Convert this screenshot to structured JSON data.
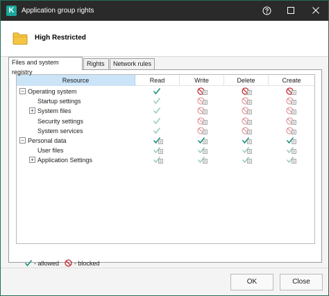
{
  "window": {
    "title": "Application group rights",
    "logo_letter": "K",
    "accent_color": "#1aa79b"
  },
  "header": {
    "group_name": "High Restricted",
    "icon": "folder-icon"
  },
  "tabs": [
    {
      "label": "Files and system registry",
      "active": true
    },
    {
      "label": "Rights",
      "active": false
    },
    {
      "label": "Network rules",
      "active": false
    }
  ],
  "grid": {
    "columns": [
      "Resource",
      "Read",
      "Write",
      "Delete",
      "Create"
    ],
    "rows": [
      {
        "label": "Operating system",
        "toggle": "−",
        "level": 0,
        "rights": [
          "allowed",
          "blocked-sub",
          "blocked-sub",
          "blocked-sub"
        ],
        "style": "dark"
      },
      {
        "label": "Startup settings",
        "toggle": "",
        "level": 1,
        "rights": [
          "allowed",
          "blocked",
          "blocked",
          "blocked"
        ],
        "style": "light"
      },
      {
        "label": "System files",
        "toggle": "+",
        "level": 1,
        "rights": [
          "allowed",
          "blocked",
          "blocked",
          "blocked"
        ],
        "style": "light"
      },
      {
        "label": "Security settings",
        "toggle": "",
        "level": 1,
        "rights": [
          "allowed",
          "blocked",
          "blocked",
          "blocked"
        ],
        "style": "light"
      },
      {
        "label": "System services",
        "toggle": "",
        "level": 1,
        "rights": [
          "allowed",
          "blocked",
          "blocked",
          "blocked"
        ],
        "style": "light"
      },
      {
        "label": "Personal data",
        "toggle": "−",
        "level": 0,
        "rights": [
          "allowed-sub",
          "allowed-sub",
          "allowed-sub",
          "allowed-sub"
        ],
        "style": "dark"
      },
      {
        "label": "User files",
        "toggle": "",
        "level": 1,
        "rights": [
          "allowed-sub",
          "allowed-sub",
          "allowed-sub",
          "allowed-sub"
        ],
        "style": "light"
      },
      {
        "label": "Application Settings",
        "toggle": "+",
        "level": 1,
        "rights": [
          "allowed-sub",
          "allowed-sub",
          "allowed-sub",
          "allowed-sub"
        ],
        "style": "light"
      }
    ]
  },
  "legend": {
    "allowed_label": "- allowed",
    "blocked_label": "- blocked"
  },
  "colors": {
    "allowed": "#1a8f7c",
    "blocked": "#c0282d",
    "selection": "#cce4f7"
  },
  "buttons": {
    "ok": "OK",
    "close": "Close"
  }
}
